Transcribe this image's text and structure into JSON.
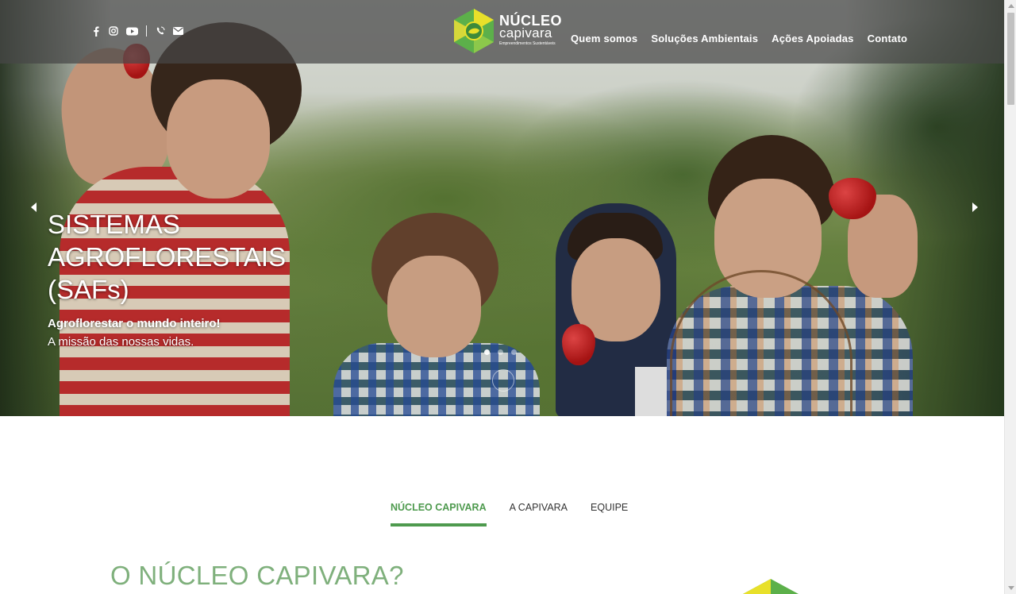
{
  "header": {
    "logo": {
      "title": "NÚCLEO",
      "subtitle": "capivara",
      "tagline": "Empreendimentos Sustentáveis"
    },
    "social_icons": [
      "facebook-icon",
      "instagram-icon",
      "youtube-icon",
      "whatsapp-icon",
      "email-icon"
    ],
    "nav": [
      {
        "label": "Quem somos"
      },
      {
        "label": "Soluções Ambientais"
      },
      {
        "label": "Ações Apoiadas"
      },
      {
        "label": "Contato"
      }
    ]
  },
  "hero": {
    "title_line1": "SISTEMAS",
    "title_line2": "AGROFLORESTAIS",
    "title_line3": "(SAFs)",
    "subtitle": "Agroflorestar o mundo inteiro!",
    "text": "A missão das nossas vidas.",
    "arrow_prev": "‹",
    "arrow_next": "›",
    "slides_count": 3,
    "active_slide": 1
  },
  "tabs": [
    {
      "label": "NÚCLEO CAPIVARA",
      "active": true
    },
    {
      "label": "A CAPIVARA",
      "active": false
    },
    {
      "label": "EQUIPE",
      "active": false
    }
  ],
  "section": {
    "title": "O NÚCLEO CAPIVARA?"
  },
  "colors": {
    "accent_green": "#4e9a4e",
    "title_green": "#7fb07c",
    "header_overlay": "#464646",
    "logo_yellow": "#e8e02a",
    "logo_green": "#5cb04a"
  }
}
